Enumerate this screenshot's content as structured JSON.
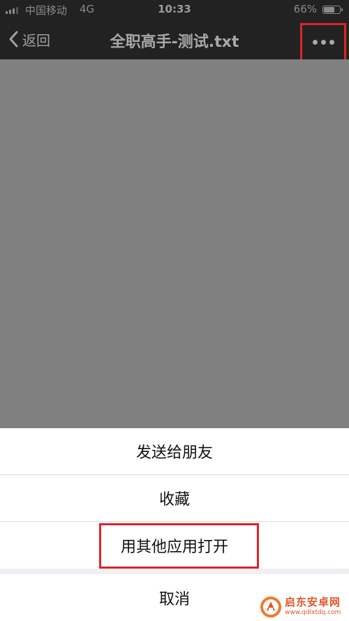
{
  "status_bar": {
    "carrier": "中国移动",
    "network": "4G",
    "time": "10:33",
    "battery_percent": "66%",
    "battery_level": 0.66
  },
  "nav_bar": {
    "back_label": "返回",
    "title": "全职高手-测试.txt",
    "more_icon": "more-dots-icon"
  },
  "action_sheet": {
    "items": [
      {
        "label": "发送给朋友"
      },
      {
        "label": "收藏"
      },
      {
        "label": "用其他应用打开"
      }
    ],
    "cancel_label": "取消"
  },
  "watermark": {
    "name": "启东安卓网",
    "url": "www.qdlxtdq.com"
  },
  "colors": {
    "highlight": "#e0232b",
    "nav_background": "#222222",
    "overlay": "#808080",
    "watermark": "#e2552a"
  }
}
